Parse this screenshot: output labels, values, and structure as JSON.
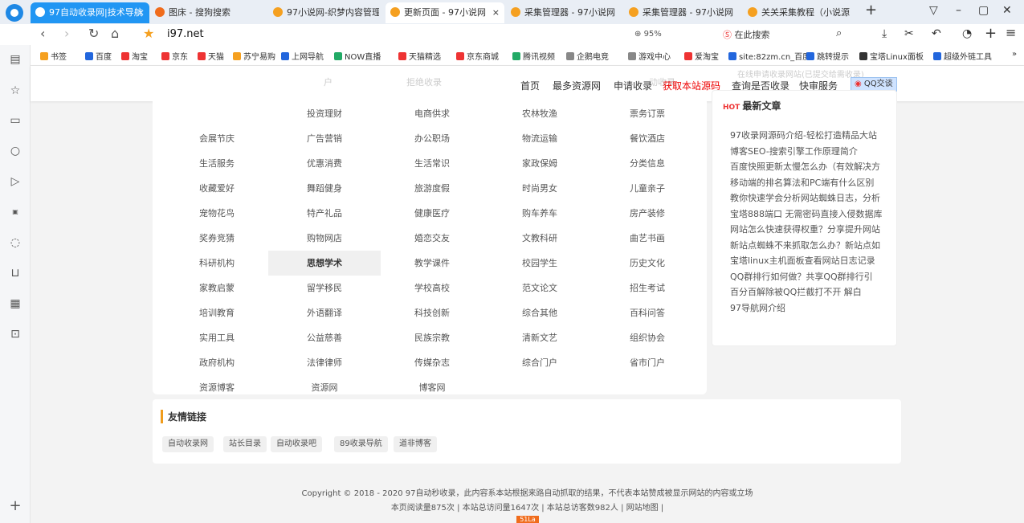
{
  "browser": {
    "tabs": [
      {
        "label": "97自动收录网|技术导航",
        "active": true
      },
      {
        "label": "图床 - 搜狗搜索"
      },
      {
        "label": "97小说网-织梦内容管理"
      },
      {
        "label": "更新页面 - 97小说网",
        "selected": true
      },
      {
        "label": "采集管理器 - 97小说网"
      },
      {
        "label": "采集管理器 - 97小说网"
      },
      {
        "label": "关关采集教程（小说源"
      }
    ],
    "new_tab": "+",
    "url": "i97.net",
    "zoom": "95%",
    "search_placeholder": "在此搜索"
  },
  "bookmarks": [
    "书签",
    "百度",
    "淘宝",
    "京东",
    "天猫",
    "苏宁易购",
    "上网导航",
    "NOW直播",
    "天猫精选",
    "京东商城",
    "腾讯视频",
    "企鹅电竞",
    "游戏中心",
    "爱淘宝",
    "site:82zm.cn_百度",
    "跳转提示",
    "宝塔Linux面板",
    "超级外链工具"
  ],
  "site": {
    "nav": [
      "首页",
      "最多资源网",
      "申请收录",
      "获取本站源码",
      "查询是否收录",
      "快审服务"
    ],
    "qq": "QQ交谈",
    "faint_top": [
      "户",
      "拒绝收录",
      "动收录",
      "在线申请收录网站(已提交给需收录)"
    ],
    "categories": [
      [
        "",
        "投资理财",
        "电商供求",
        "农林牧渔",
        "票务订票"
      ],
      [
        "会展节庆",
        "广告营销",
        "办公职场",
        "物流运输",
        "餐饮酒店"
      ],
      [
        "生活服务",
        "优惠消费",
        "生活常识",
        "家政保姆",
        "分类信息"
      ],
      [
        "收藏爱好",
        "舞蹈健身",
        "旅游度假",
        "时尚男女",
        "儿童亲子"
      ],
      [
        "宠物花鸟",
        "特产礼品",
        "健康医疗",
        "购车养车",
        "房产装修"
      ],
      [
        "奖券竞猜",
        "购物网店",
        "婚恋交友",
        "文教科研",
        "曲艺书画"
      ],
      [
        "科研机构",
        "思想学术",
        "教学课件",
        "校园学生",
        "历史文化"
      ],
      [
        "家教启蒙",
        "留学移民",
        "学校高校",
        "范文论文",
        "招生考试"
      ],
      [
        "培训教育",
        "外语翻译",
        "科技创新",
        "综合其他",
        "百科问答"
      ],
      [
        "实用工具",
        "公益慈善",
        "民族宗教",
        "清新文艺",
        "组织协会"
      ],
      [
        "政府机构",
        "法律律师",
        "传媒杂志",
        "综合门户",
        "省市门户"
      ],
      [
        "资源博客",
        "资源网",
        "博客网",
        "",
        ""
      ]
    ],
    "latest_title": "最新文章",
    "hot_badge": "HOT",
    "articles": [
      "97收录网源码介绍-轻松打造精品大站",
      "博客SEO-搜索引擎工作原理简介",
      "百度快照更新太慢怎么办（有效解决方",
      "移动端的排名算法和PC端有什么区别",
      "教你快速学会分析网站蜘蛛日志，分析",
      "宝塔888端口 无需密码直接入侵数据库",
      "网站怎么快速获得权重？分享提升网站",
      "新站点蜘蛛不来抓取怎么办？新站点如",
      "宝塔linux主机面板查看网站日志记录",
      "QQ群排行如何做？共享QQ群排行引",
      "百分百解除被QQ拦截打不开 解白",
      "97导航网介绍"
    ],
    "links_title": "友情链接",
    "links": [
      "自动收录网",
      "站长目录",
      "自动收录吧",
      "89收录导航",
      "道非博客"
    ],
    "footer1": "Copyright © 2018 - 2020 97自动秒收录，此内容系本站根据来路自动抓取的结果，不代表本站赞成被显示网站的内容或立场",
    "footer2": "本页阅读量875次 | 本站总访问量1647次 | 本站总访客数982人 | 网站地图 |",
    "badge": "51La"
  }
}
